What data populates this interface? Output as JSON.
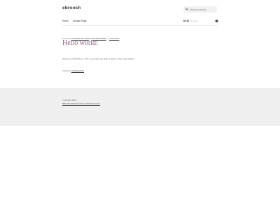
{
  "header": {
    "site_title": "ebroosh",
    "search": {
      "placeholder": "Search products…"
    },
    "nav": {
      "items": [
        "Home",
        "Sample Page"
      ]
    },
    "cart": {
      "amount": "$0.00",
      "count": "0 items"
    }
  },
  "post": {
    "meta": {
      "prefix": "Posted on ",
      "date": "November 18, 2024",
      "by": " by ",
      "author": "ftatnkedbm4009",
      "separator": " — ",
      "comments": "1 Comment"
    },
    "title": "Hello world!",
    "body": "Welcome to WordPress. This is your first post. Edit or delete it, then start writing!",
    "category": {
      "prefix": "Category: ",
      "name": "Uncategorized"
    }
  },
  "footer": {
    "copyright": "© ebroosh 2024",
    "credit_link": "Built with WooCommerce & WooCommerce"
  },
  "colors": {
    "accent": "#96588a",
    "footer_bg": "#f0f0f0",
    "search_bg": "#f2f2f2"
  }
}
